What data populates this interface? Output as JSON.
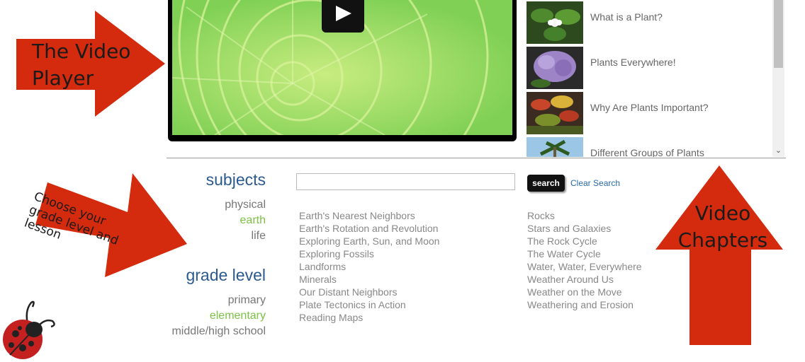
{
  "annotations": {
    "video_player": "The Video Player",
    "choose_grade": "Choose your grade level and lesson",
    "video_chapters": "Video Chapters"
  },
  "chapters": [
    {
      "title": "What is a Plant?"
    },
    {
      "title": "Plants Everywhere!"
    },
    {
      "title": "Why Are Plants Important?"
    },
    {
      "title": "Different Groups of Plants"
    }
  ],
  "filters": {
    "subjects_heading": "subjects",
    "subjects": [
      "physical",
      "earth",
      "life"
    ],
    "active_subject": "earth",
    "grade_heading": "grade level",
    "grades": [
      "primary",
      "elementary",
      "middle/high school"
    ],
    "active_grade": "elementary"
  },
  "search": {
    "value": "",
    "button_label": "search",
    "clear_label": "Clear Search"
  },
  "lessons": {
    "column1": [
      "Earth's Nearest Neighbors",
      "Earth's Rotation and Revolution",
      "Exploring Earth, Sun, and Moon",
      "Exploring Fossils",
      "Landforms",
      "Minerals",
      "Our Distant Neighbors",
      "Plate Tectonics in Action",
      "Reading Maps"
    ],
    "column2": [
      "Rocks",
      "Stars and Galaxies",
      "The Rock Cycle",
      "The Water Cycle",
      "Water, Water, Everywhere",
      "Weather Around Us",
      "Weather on the Move",
      "Weathering and Erosion"
    ]
  },
  "colors": {
    "accent_green": "#7cc245",
    "heading_blue": "#2b5a8f",
    "arrow_red": "#d42a0e"
  }
}
